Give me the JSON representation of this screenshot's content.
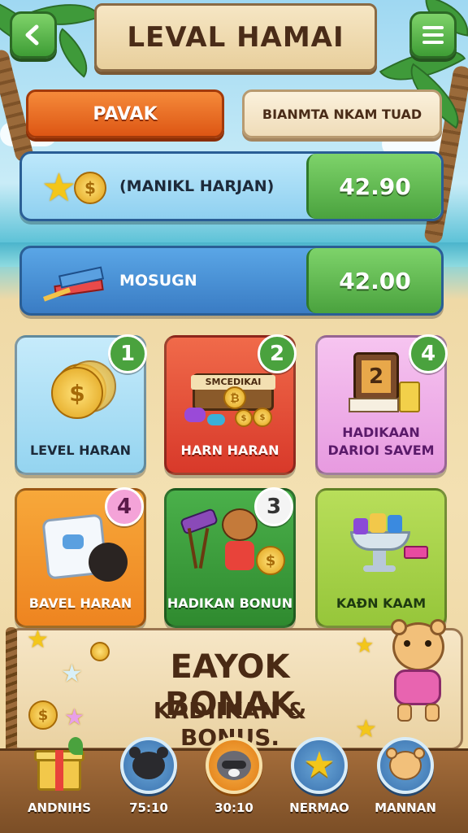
{
  "header": {
    "title": "LEVAL HAMAI",
    "back_icon": "back-arrow-icon",
    "menu_icon": "hamburger-menu-icon"
  },
  "tabs": [
    {
      "label": "PAVAK",
      "active": true
    },
    {
      "label": "BIANMTA NKAM TUAD",
      "active": false
    }
  ],
  "stats": [
    {
      "label": "(MANIKL HARJAN)",
      "value": "42.90",
      "icon": "star-coin-icon"
    },
    {
      "label": "MOSUGN",
      "value": "42.00",
      "icon": "books-icon"
    }
  ],
  "tiles": [
    {
      "label": "LEVEL HARAN",
      "badge": "1",
      "icon": "coin-stack-icon",
      "sign": ""
    },
    {
      "label": "HARN HARAN",
      "badge": "2",
      "icon": "treasure-chest-icon",
      "sign": "SMCEDIKAI"
    },
    {
      "label": "HADIKAAN DARIOI SAVEM",
      "badge": "4",
      "icon": "book-and-pencils-icon",
      "sign": ""
    },
    {
      "label": "BAVEL HARAN",
      "badge": "4",
      "icon": "dice-and-ball-icon",
      "sign": ""
    },
    {
      "label": "HADIKAN BONUN",
      "badge": "3",
      "icon": "raccoon-telescope-icon",
      "sign": ""
    },
    {
      "label": "KAƉN KAAM",
      "badge": "",
      "icon": "fruit-bowl-icon",
      "sign": ""
    }
  ],
  "banner": {
    "title": "EAYOK BONAK",
    "subtitle": "KADIIKAN & BONUS."
  },
  "bottom_nav": [
    {
      "label": "ANDNIHS",
      "icon": "gift-box-icon"
    },
    {
      "label": "75:10",
      "icon": "bear-avatar-icon"
    },
    {
      "label": "30:10",
      "icon": "raccoon-avatar-icon"
    },
    {
      "label": "NERMAO",
      "icon": "star-icon"
    },
    {
      "label": "MANNAN",
      "icon": "teddy-avatar-icon"
    }
  ],
  "colors": {
    "green": "#4aa23e",
    "orange_tab": "#e8641c",
    "tile_blue": "#a9dcf2",
    "tile_red": "#e54b2e",
    "tile_pink": "#f0a8e6",
    "tile_orange": "#f59426",
    "tile_green": "#3e9e3a",
    "tile_lime": "#a9d64a",
    "nav_brown": "#7b4e26"
  }
}
